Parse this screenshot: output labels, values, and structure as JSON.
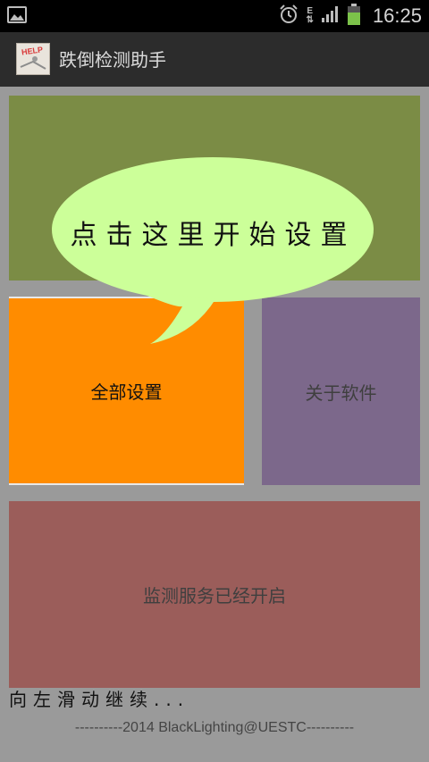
{
  "status_bar": {
    "time": "16:25",
    "network_letter": "E",
    "icons": [
      "gallery-icon",
      "alarm-icon",
      "data-arrows-icon",
      "signal-icon",
      "battery-icon"
    ]
  },
  "app_bar": {
    "icon_text": "HELP",
    "title": "跌倒检测助手"
  },
  "overlay": {
    "bubble_text": "点击这里开始设置"
  },
  "tiles": {
    "settings": "全部设置",
    "about": "关于软件",
    "service": "监测服务已经开启"
  },
  "hint": "向左滑动继续...",
  "footer": "----------2014 BlackLighting@UESTC----------",
  "colors": {
    "tile_top": "#7b8c45",
    "tile_settings": "#ff8c00",
    "tile_about": "#7c688b",
    "tile_service": "#9b5d5a",
    "bubble": "#ccff99"
  }
}
